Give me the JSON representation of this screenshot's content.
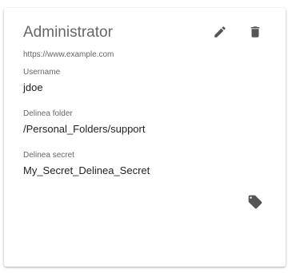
{
  "card": {
    "title": "Administrator",
    "url": "https://www.example.com",
    "fields": [
      {
        "label": "Username",
        "value": "jdoe"
      },
      {
        "label": "Delinea folder",
        "value": "/Personal_Folders/support"
      },
      {
        "label": "Delinea secret",
        "value": "My_Secret_Delinea_Secret"
      }
    ],
    "actions": {
      "edit_icon": "pencil-icon",
      "delete_icon": "trash-icon",
      "tag_icon": "tag-icon"
    }
  },
  "colors": {
    "title": "#666666",
    "label": "#666666",
    "value": "#222222",
    "icon": "#555555"
  }
}
